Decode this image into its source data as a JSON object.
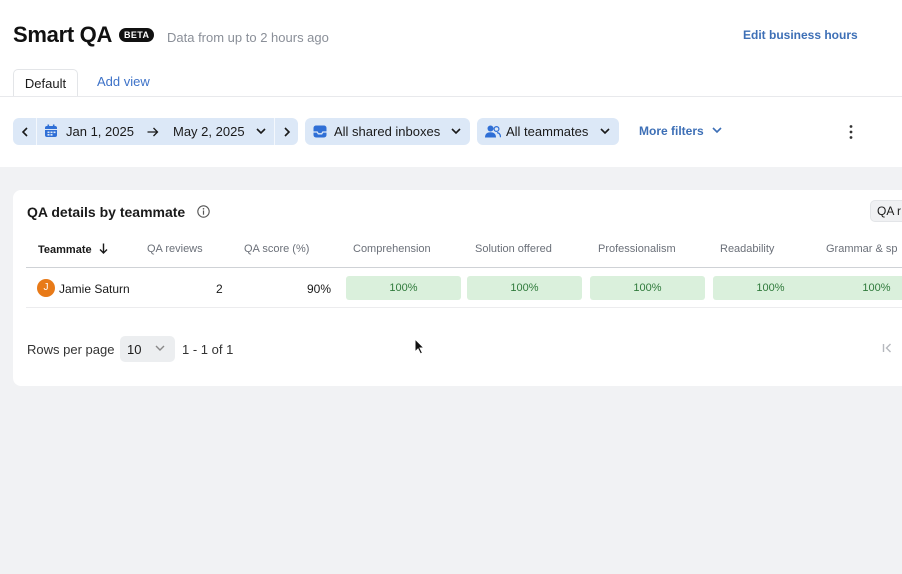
{
  "header": {
    "title": "Smart QA",
    "badge": "BETA",
    "subtitle": "Data from up to 2 hours ago",
    "edit_hours_label": "Edit business hours"
  },
  "tabs": [
    {
      "label": "Default",
      "active": true
    },
    {
      "label": "Add view",
      "active": false
    }
  ],
  "filters": {
    "date_start": "Jan 1, 2025",
    "date_end": "May 2, 2025",
    "inbox_label": "All shared inboxes",
    "teammates_label": "All teammates",
    "more_filters_label": "More filters"
  },
  "icons": {
    "prev": "chevron-left-icon",
    "next": "chevron-right-icon",
    "calendar": "calendar-icon",
    "arrow": "arrow-right-icon",
    "inbox": "inbox-icon",
    "people": "people-icon",
    "more": "kebab-icon",
    "info": "info-icon",
    "sort": "arrow-down-icon",
    "first_page": "first-page-icon"
  },
  "card": {
    "title": "QA details by teammate",
    "qa_button_label": "QA r",
    "columns": [
      "Teammate",
      "QA reviews",
      "QA score (%)",
      "Comprehension",
      "Solution offered",
      "Professionalism",
      "Readability",
      "Grammar & sp"
    ],
    "rows": [
      {
        "avatar_initial": "J",
        "name": "Jamie Saturn",
        "qa_reviews": "2",
        "qa_score": "90%",
        "scores": [
          "100%",
          "100%",
          "100%",
          "100%",
          "100%"
        ]
      }
    ],
    "pagination": {
      "rows_per_page_label": "Rows per page",
      "rows_per_page_value": "10",
      "range_text": "1 - 1 of 1"
    }
  },
  "colors": {
    "accent": "#3d6fb6",
    "pill_bg": "#dce8f7",
    "score_bg": "#daf0dc",
    "score_text": "#2f7a3b",
    "avatar": "#e87a18"
  }
}
